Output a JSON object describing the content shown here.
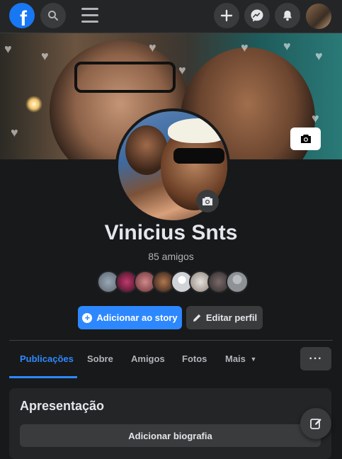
{
  "topbar": {
    "logo_glyph": "f",
    "icons": [
      "search-icon",
      "menu-icon",
      "plus-icon",
      "messenger-icon",
      "notifications-bell-icon",
      "account-avatar"
    ]
  },
  "profile": {
    "name": "Vinicius Snts",
    "friends_count": "85 amigos"
  },
  "actions": {
    "add_story": "Adicionar ao story",
    "edit_profile": "Editar perfil"
  },
  "tabs": [
    {
      "label": "Publicações",
      "active": true
    },
    {
      "label": "Sobre"
    },
    {
      "label": "Amigos"
    },
    {
      "label": "Fotos"
    },
    {
      "label": "Mais"
    }
  ],
  "more_button": "···",
  "intro_card": {
    "title": "Apresentação",
    "add_bio": "Adicionar biografia"
  },
  "colors": {
    "accent": "#2d88ff",
    "background": "#18191a",
    "surface": "#242526",
    "button": "#3a3b3c"
  }
}
